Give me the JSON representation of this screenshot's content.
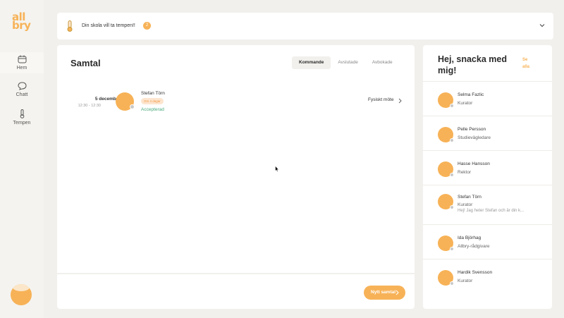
{
  "logo": {
    "line1": "all",
    "line2": "bry"
  },
  "sidebar": {
    "items": [
      {
        "label": "Hem",
        "icon": "calendar-icon",
        "active": true
      },
      {
        "label": "Chatt",
        "icon": "chat-bubble-icon",
        "active": false
      },
      {
        "label": "Tempen",
        "icon": "thermometer-icon",
        "active": false
      }
    ]
  },
  "banner": {
    "text": "Din skola vill ta tempen!!",
    "count": "2"
  },
  "main": {
    "title": "Samtal",
    "tabs": [
      "Kommande",
      "Avslutade",
      "Avbokade"
    ],
    "active_tab": "Kommande",
    "meetings": [
      {
        "date": "5 december",
        "time": "12:30 - 12:30",
        "name": "Stefan Törn",
        "pill": "Om 4 dagar",
        "status": "Accepterad",
        "type": "Fysiskt möte"
      }
    ],
    "new_button": "Nytt samtal"
  },
  "right": {
    "heading": "Hej, snacka med mig!",
    "see_all_line1": "Se",
    "see_all_line2": "alla",
    "contacts": [
      {
        "name": "Selma Fazlic",
        "role": "Kurator",
        "message": ""
      },
      {
        "name": "Pelle Persson",
        "role": "Studievägledare",
        "message": ""
      },
      {
        "name": "Hasse Hansson",
        "role": "Rektor",
        "message": ""
      },
      {
        "name": "Stefan Törn",
        "role": "Kurator",
        "message": "Hej! Jag heter Stefan och är din k..."
      },
      {
        "name": "Ida Björhag",
        "role": "Allbry-rådgivare",
        "message": ""
      },
      {
        "name": "Hardik Svensson",
        "role": "Kurator",
        "message": ""
      }
    ]
  },
  "colors": {
    "accent": "#f7b257",
    "background": "#f1f0ec",
    "status_green": "#4aaa7c"
  }
}
